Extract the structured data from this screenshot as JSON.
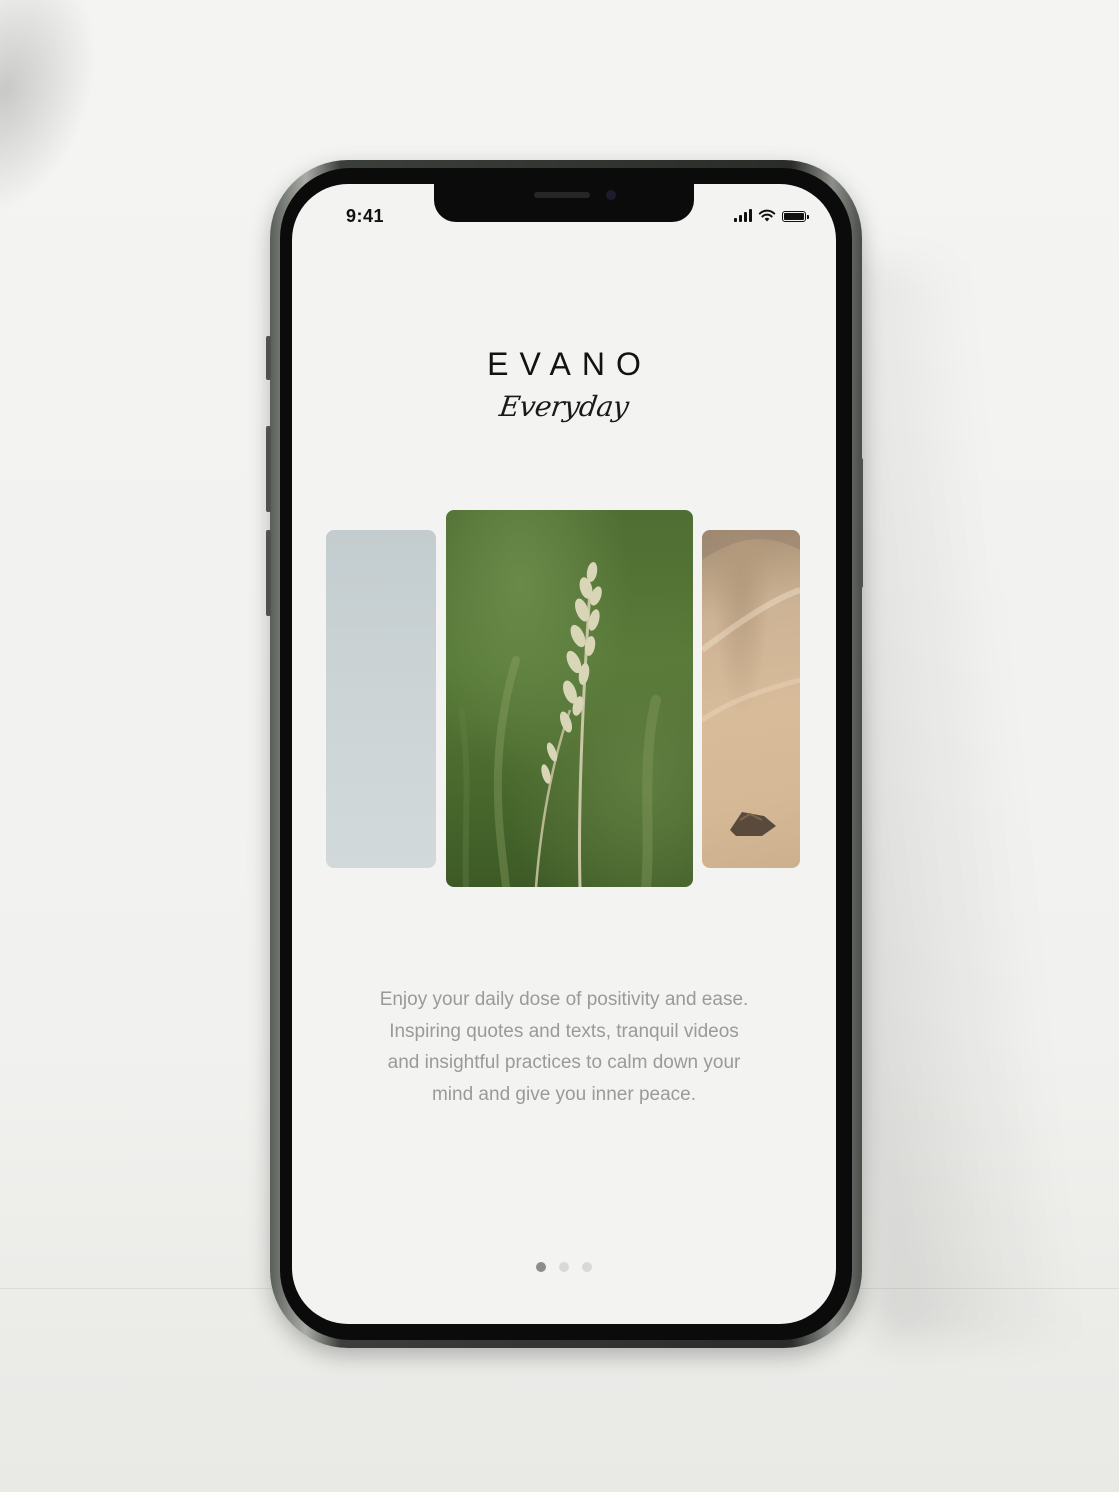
{
  "status_bar": {
    "time": "9:41",
    "icons": [
      "signal-icon",
      "wifi-icon",
      "battery-icon"
    ]
  },
  "brand": {
    "logo": "EVANO",
    "tagline": "Everyday"
  },
  "carousel": {
    "cards": [
      {
        "name": "pale-sky-image",
        "position": "previous"
      },
      {
        "name": "grass-stalk-image",
        "position": "current"
      },
      {
        "name": "sand-and-stone-image",
        "position": "next"
      }
    ]
  },
  "description": "Enjoy your daily dose of positivity and ease. Inspiring quotes and texts, tranquil videos and insightful practices to calm down your mind and give you inner peace.",
  "pagination": {
    "total": 3,
    "active": 1
  },
  "colors": {
    "screen_background": "#f3f3f1",
    "text_primary": "#121212",
    "text_muted": "#9a9a98",
    "dot_active": "#8d8d8b",
    "dot_inactive": "#d9d9d7"
  }
}
